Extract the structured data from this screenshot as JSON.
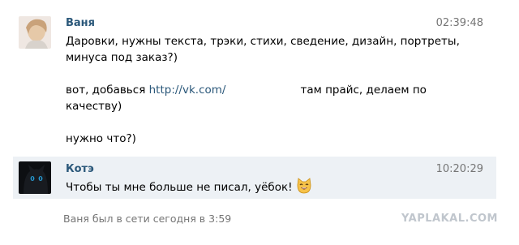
{
  "messages": [
    {
      "author": "Ваня",
      "time": "02:39:48",
      "line1": "Даровки, нужны текста, трэки, стихи, сведение, дизайн, портреты,",
      "line2": "минуса под заказ?)",
      "line3_prefix": "вот, добавься ",
      "line3_link": "http://vk.com/",
      "line3_suffix": "там прайс, делаем по",
      "line4": "качеству)",
      "line5": "нужно что?)"
    },
    {
      "author": "Котэ",
      "time": "10:20:29",
      "text": "Чтобы ты мне больше не писал, уёбок!",
      "emoji": "cat-smile-icon"
    }
  ],
  "status": "Ваня был в сети сегодня в 3:59",
  "watermark": "YAPLAKAL.COM"
}
